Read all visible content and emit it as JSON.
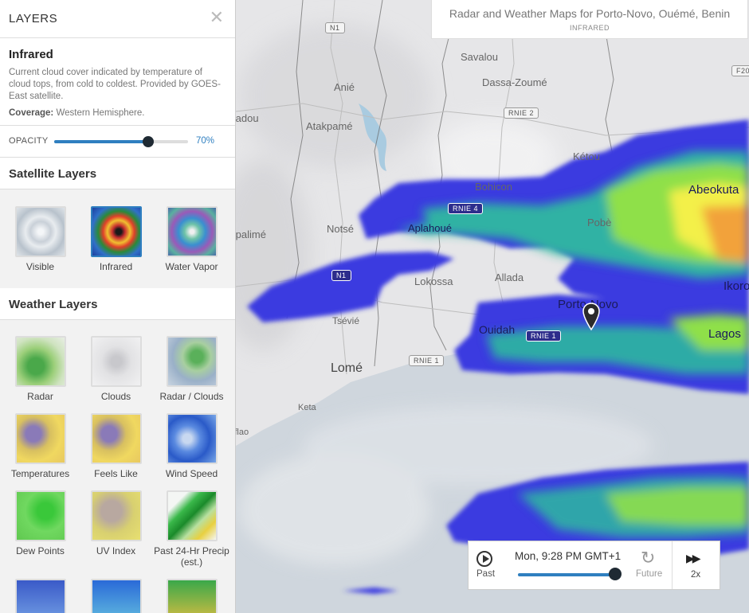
{
  "panel": {
    "title": "LAYERS",
    "close": "✕",
    "layer": {
      "name": "Infrared",
      "description": "Current cloud cover indicated by temperature of cloud tops, from cold to coldest. Provided by GOES-East satellite.",
      "coverage_label": "Coverage:",
      "coverage_value": "Western Hemisphere."
    },
    "opacity": {
      "label": "OPACITY",
      "value_text": "70%",
      "value": 0.7
    },
    "satellite": {
      "title": "Satellite Layers",
      "items": [
        "Visible",
        "Infrared",
        "Water Vapor"
      ],
      "selected": "Infrared"
    },
    "weather": {
      "title": "Weather Layers",
      "items": [
        "Radar",
        "Clouds",
        "Radar / Clouds",
        "Temperatures",
        "Feels Like",
        "Wind Speed",
        "Dew Points",
        "UV Index",
        "Past 24-Hr Precip (est.)"
      ]
    }
  },
  "header": {
    "title": "Radar and Weather Maps for Porto-Novo, Ouémé, Benin",
    "subtitle": "INFRARED"
  },
  "map": {
    "cities": [
      "Savalou",
      "Dassa-Zoumé",
      "Anié",
      "Atakpamé",
      "Kétou",
      "Bohicon",
      "Abeokuta",
      "Aplahoué",
      "Pobè",
      "Notsé",
      "Lokossa",
      "Allada",
      "Porto-Novo",
      "Ouidah",
      "Lagos",
      "Ikorodu",
      "Tsévié",
      "Lomé",
      "Keta",
      "Aflao",
      "Kpalimé",
      "Badou"
    ],
    "roads": [
      "N1",
      "RNIE 2",
      "RNIE 4",
      "N1",
      "RNIE 1",
      "RNIE 1",
      "F20"
    ]
  },
  "player": {
    "past": "Past",
    "time": "Mon, 9:28 PM GMT+1",
    "future": "Future",
    "speed": "2x",
    "progress": 0.92
  }
}
